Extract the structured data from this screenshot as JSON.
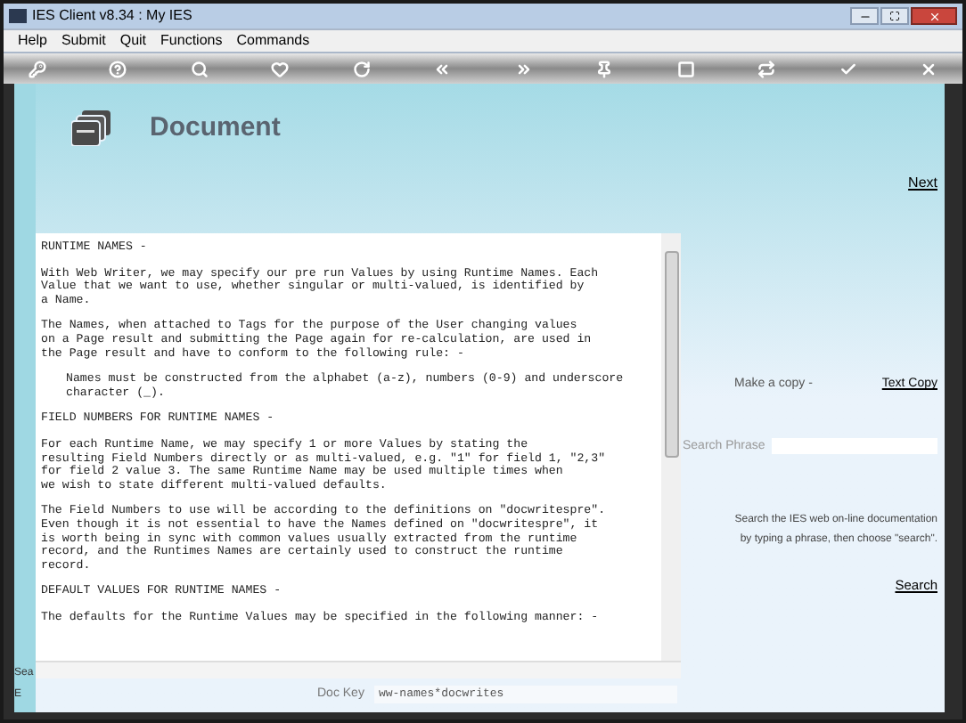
{
  "window": {
    "title": "IES Client v8.34 : My IES"
  },
  "menu": [
    "Help",
    "Submit",
    "Quit",
    "Functions",
    "Commands"
  ],
  "page": {
    "title": "Document",
    "next_link": "Next"
  },
  "document": [
    {
      "kind": "heading",
      "text": "RUNTIME NAMES -"
    },
    {
      "kind": "paragraph",
      "text": "With Web Writer, we may specify our pre run Values by using Runtime Names. Each\nValue that we want to use, whether singular or multi-valued, is identified by\na Name."
    },
    {
      "kind": "paragraph",
      "text": "The Names, when attached to Tags for the purpose of the User changing values\non a Page result and submitting the Page again for re-calculation, are used in\nthe Page result and have to conform to the following rule: -"
    },
    {
      "kind": "indented",
      "text": "Names must be constructed from the alphabet (a-z), numbers (0-9) and underscore\ncharacter (_)."
    },
    {
      "kind": "heading",
      "text": "FIELD NUMBERS FOR RUNTIME NAMES -"
    },
    {
      "kind": "paragraph",
      "text": "For each Runtime Name, we may specify 1 or more Values by stating the\nresulting Field Numbers directly or as multi-valued, e.g. \"1\" for field 1, \"2,3\"\nfor field 2 value 3. The same Runtime Name may be used multiple times when\nwe wish to state different multi-valued defaults."
    },
    {
      "kind": "paragraph",
      "text": "The Field Numbers to use will be according to the definitions on \"docwritespre\".\nEven though it is not essential to have the Names defined on \"docwritespre\", it\nis worth being in sync with common values usually extracted from the runtime\nrecord, and the Runtimes Names are certainly used to construct the runtime\nrecord."
    },
    {
      "kind": "heading",
      "text": "DEFAULT VALUES FOR RUNTIME NAMES -"
    },
    {
      "kind": "paragraph",
      "text": "The defaults for the Runtime Values may be specified in the following manner: -"
    }
  ],
  "copy": {
    "label": "Make a copy -",
    "link": "Text Copy"
  },
  "search": {
    "label": "Search Phrase",
    "help": "Search the IES web on-line documentation\nby typing a phrase, then choose \"search\".",
    "link": "Search"
  },
  "doc_key": {
    "label": "Doc Key",
    "value": "ww-names*docwrites"
  },
  "left_edge": [
    "Sea",
    "E"
  ]
}
